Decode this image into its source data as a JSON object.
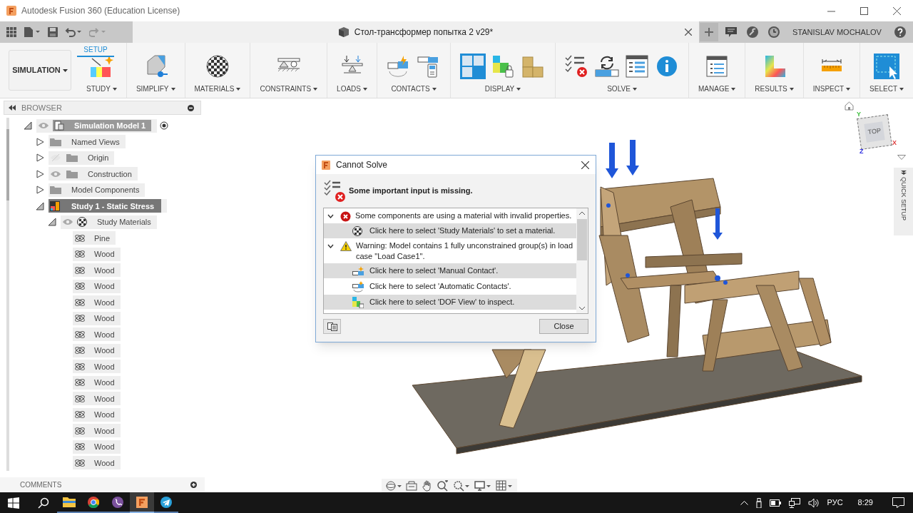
{
  "window": {
    "title": "Autodesk Fusion 360 (Education License)"
  },
  "tab_bar": {
    "document_title": "Стол-трансформер попытка 2 v29*",
    "user_name": "STANISLAV MOCHALOV"
  },
  "toolbar": {
    "workspace": "SIMULATION",
    "tabs": [
      {
        "label": "SETUP",
        "selected": true
      }
    ],
    "groups": [
      {
        "label": "STUDY"
      },
      {
        "label": "SIMPLIFY"
      },
      {
        "label": "MATERIALS"
      },
      {
        "label": "CONSTRAINTS"
      },
      {
        "label": "LOADS"
      },
      {
        "label": "CONTACTS"
      },
      {
        "label": "DISPLAY"
      },
      {
        "label": "SOLVE"
      },
      {
        "label": "MANAGE"
      },
      {
        "label": "RESULTS"
      },
      {
        "label": "INSPECT"
      },
      {
        "label": "SELECT"
      }
    ]
  },
  "browser": {
    "title": "BROWSER",
    "tree": [
      {
        "kind": "model",
        "label": "Simulation Model 1",
        "visible": true,
        "expanded": true,
        "children": [
          {
            "kind": "folder",
            "label": "Named Views",
            "expanded": false
          },
          {
            "kind": "folder",
            "label": "Origin",
            "visible": false,
            "expanded": false
          },
          {
            "kind": "folder",
            "label": "Construction",
            "visible": true,
            "expanded": false
          },
          {
            "kind": "folder",
            "label": "Model Components",
            "expanded": false
          },
          {
            "kind": "study",
            "label": "Study 1 - Static Stress",
            "expanded": true,
            "children": [
              {
                "kind": "materials",
                "label": "Study Materials",
                "visible": true,
                "expanded": true,
                "children": [
                  {
                    "kind": "material",
                    "label": "Pine"
                  },
                  {
                    "kind": "material",
                    "label": "Wood"
                  },
                  {
                    "kind": "material",
                    "label": "Wood"
                  },
                  {
                    "kind": "material",
                    "label": "Wood"
                  },
                  {
                    "kind": "material",
                    "label": "Wood"
                  },
                  {
                    "kind": "material",
                    "label": "Wood"
                  },
                  {
                    "kind": "material",
                    "label": "Wood"
                  },
                  {
                    "kind": "material",
                    "label": "Wood"
                  },
                  {
                    "kind": "material",
                    "label": "Wood"
                  },
                  {
                    "kind": "material",
                    "label": "Wood"
                  },
                  {
                    "kind": "material",
                    "label": "Wood"
                  },
                  {
                    "kind": "material",
                    "label": "Wood"
                  },
                  {
                    "kind": "material",
                    "label": "Wood"
                  },
                  {
                    "kind": "material",
                    "label": "Wood"
                  },
                  {
                    "kind": "material",
                    "label": "Wood"
                  }
                ]
              }
            ]
          }
        ]
      }
    ]
  },
  "comments": {
    "title": "COMMENTS"
  },
  "view_cube": {
    "face": "TOP",
    "axes": [
      "Y",
      "X",
      "Z"
    ]
  },
  "quick_setup": {
    "label": "QUICK SETUP"
  },
  "dialog": {
    "title": "Cannot Solve",
    "heading": "Some important input is missing.",
    "close_button": "Close",
    "issues": [
      {
        "kind": "error",
        "text": "Some components are using a material with invalid properties.",
        "expanded": true,
        "actions": [
          {
            "kind": "materials",
            "text": "Click here to select 'Study Materials' to set a material.",
            "selected": true
          }
        ]
      },
      {
        "kind": "warning",
        "text": "Warning: Model contains 1 fully unconstrained group(s) in load case \"Load Case1\".",
        "expanded": true,
        "actions": [
          {
            "kind": "manual_contact",
            "text": "Click here to select 'Manual Contact'.",
            "selected": true
          },
          {
            "kind": "automatic_contacts",
            "text": "Click here to select 'Automatic Contacts'.",
            "selected": false
          },
          {
            "kind": "dof_view",
            "text": "Click here to select 'DOF View' to inspect.",
            "selected": true
          }
        ]
      }
    ]
  },
  "taskbar": {
    "apps": [
      {
        "kind": "explorer",
        "active": false
      },
      {
        "kind": "chrome",
        "active": false
      },
      {
        "kind": "viber",
        "active": false
      },
      {
        "kind": "fusion",
        "active": true
      },
      {
        "kind": "telegram",
        "active": false
      }
    ],
    "language": "РУС",
    "time": "8:29"
  }
}
